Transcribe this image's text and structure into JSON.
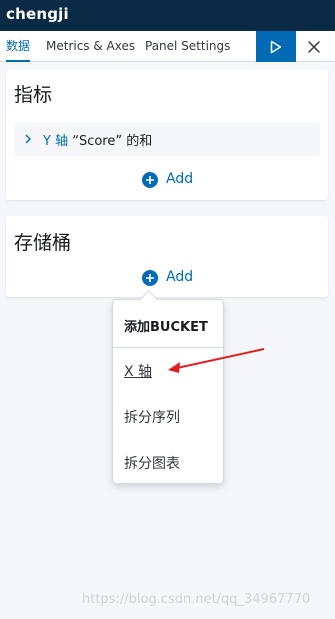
{
  "app": {
    "title": "chengji"
  },
  "tabs": [
    {
      "label": "数据",
      "active": true
    },
    {
      "label": "Metrics & Axes",
      "active": false
    },
    {
      "label": "Panel Settings",
      "active": false
    }
  ],
  "toolbar": {
    "apply_icon": "play-icon",
    "close_icon": "close-icon"
  },
  "metrics_panel": {
    "title": "指标",
    "item": {
      "axis": "Y 轴",
      "desc": "“Score” 的和"
    },
    "add_label": "Add"
  },
  "buckets_panel": {
    "title": "存储桶",
    "add_label": "Add"
  },
  "popover": {
    "title": "添加BUCKET",
    "items": [
      "X 轴",
      "拆分序列",
      "拆分图表"
    ]
  },
  "watermark": "https://blog.csdn.net/qq_34967770",
  "colors": {
    "topbar": "#0b2a45",
    "accent": "#006bb4",
    "annotation_arrow": "#e02020"
  }
}
